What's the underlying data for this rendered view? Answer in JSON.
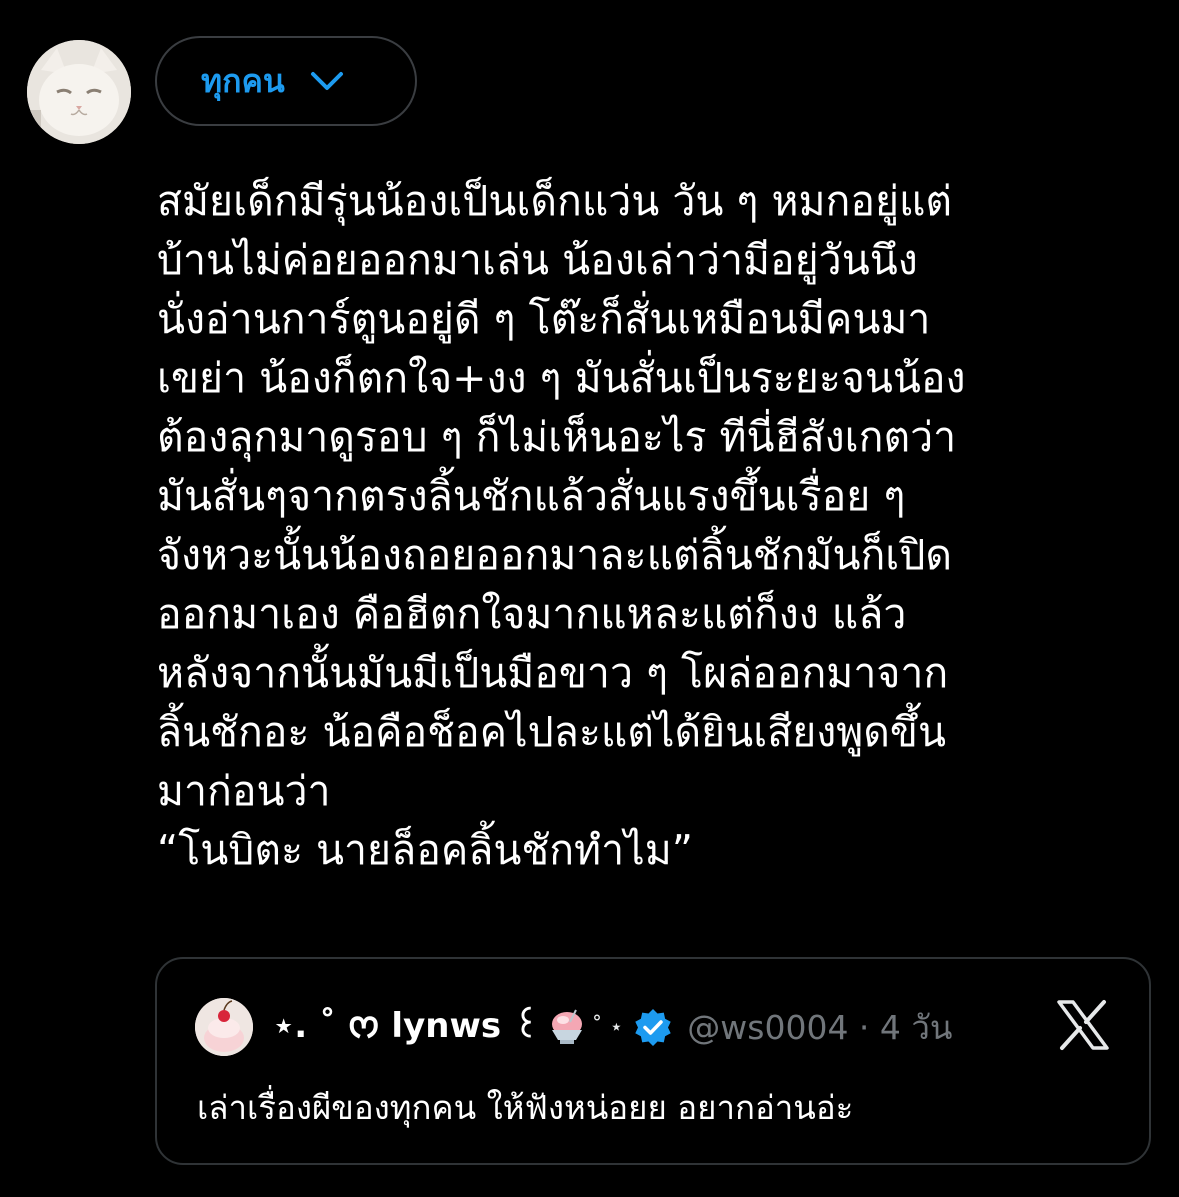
{
  "post": {
    "audience_label": "ทุกคน",
    "text": "สมัยเด็กมีรุ่นน้องเป็นเด็กแว่น วัน ๆ หมกอยู่แต่\nบ้านไม่ค่อยออกมาเล่น น้องเล่าว่ามีอยู่วันนึง\nนั่งอ่านการ์ตูนอยู่ดี ๆ โต๊ะก็สั่นเหมือนมีคนมา\nเขย่า น้องก็ตกใจ+งง ๆ มันสั่นเป็นระยะจนน้อง\nต้องลุกมาดูรอบ ๆ ก็ไม่เห็นอะไร ทีนี่ฮีสังเกตว่า\nมันสั่นๆจากตรงลิ้นชักแล้วสั่นแรงขึ้นเรื่อย ๆ\nจังหวะนั้นน้องถอยออกมาละแต่ลิ้นชักมันก็เปิด\nออกมาเอง คือฮีตกใจมากแหละแต่ก็งง แล้ว\nหลังจากนั้นมันมีเป็นมือขาว ๆ โผล่ออกมาจาก\nลิ้นชักอะ น้อคือช็อคไปละแต่ได้ยินเสียงพูดขึ้น\nมาก่อนว่า\n“โนบิตะ นายล็อคลิ้นชักทำไม”"
  },
  "quoted": {
    "display_name": "⋆. ˚ ᰔ lynws ꒰",
    "name_suffix": "˚ ⋆",
    "handle_time": "@ws0004 · 4 วัน",
    "text": "เล่าเรื่องผีของทุกคน ให้ฟังหน่อยย อยากอ่านอ่ะ"
  },
  "colors": {
    "background": "#000000",
    "accent": "#1d9bf0",
    "text": "#ffffff",
    "muted": "#71767b",
    "border": "#2f3336"
  },
  "icons": {
    "audience": "chevron-down-icon",
    "verified": "verified-badge-icon",
    "platform": "x-logo-icon",
    "decoration": "shaved-ice-icon"
  }
}
